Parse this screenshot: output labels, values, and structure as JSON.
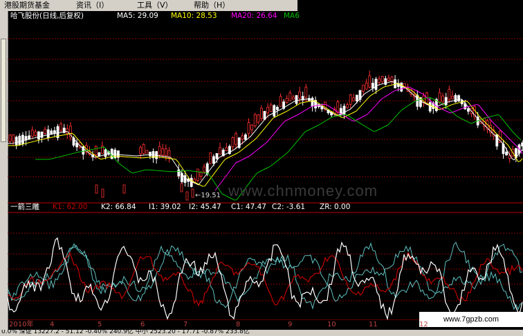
{
  "menu": {
    "items": [
      {
        "label": "港股期货基金"
      },
      {
        "label": "资讯（I）"
      },
      {
        "label": "工具（V）"
      },
      {
        "label": "帮助（H）"
      }
    ]
  },
  "price_panel": {
    "stock": "哈飞股份(日线,后复权)",
    "ma5": "MA5: 29.09",
    "ma10": "MA10: 28.53",
    "ma20": "MA20: 26.64",
    "ma60": "MA6"
  },
  "indicator_panel": {
    "name": "一箭三雕",
    "k1": "K1: 62.00",
    "k2": "K2: 66.84",
    "i1": "I1: 39.02",
    "i2": "I2: 45.47",
    "c1": "C1: 47.47",
    "c2": "C2: -3.61",
    "zr": "ZR: 0.00"
  },
  "low_price_label": "←19.51",
  "date_axis": {
    "labels": [
      "2010年",
      "4",
      "5",
      "6",
      "7",
      "8",
      "9",
      "10",
      "11",
      "12"
    ]
  },
  "watermark": {
    "mid": "www.chnmoney.com",
    "corner": "www.7gpzb.com"
  },
  "status_bar": {
    "text": "0.0% 深证 13227.2 - 51.12 -0.40% 240.9亿 中小 2523.20 - 17.71 -0.87% 233.8亿"
  },
  "colors": {
    "candle_up": "#ff3030",
    "candle_down": "#ffffff",
    "ma5": "#ffffff",
    "ma10": "#ffff00",
    "ma20": "#ff00ff",
    "ma60": "#00c000",
    "k_line": "#ffffff",
    "red_line": "#c00000",
    "cyan_line": "#60c0c0"
  }
}
